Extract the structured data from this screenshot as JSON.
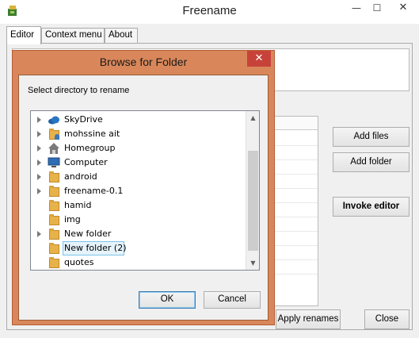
{
  "window": {
    "title": "Freename",
    "minimize": "—",
    "maximize": "☐",
    "close": "✕"
  },
  "tabs": [
    {
      "label": "Editor"
    },
    {
      "label": "Context menu"
    },
    {
      "label": "About"
    }
  ],
  "buttons": {
    "add_files": "Add files",
    "add_folder": "Add folder",
    "invoke_editor": "Invoke editor",
    "apply_renames": "Apply renames",
    "close": "Close"
  },
  "dialog": {
    "title": "Browse for Folder",
    "close": "✕",
    "prompt": "Select directory to rename",
    "ok": "OK",
    "cancel": "Cancel",
    "tree": [
      {
        "label": "SkyDrive",
        "icon": "cloud-icon",
        "expandable": true
      },
      {
        "label": "mohssine ait",
        "icon": "user-folder-icon",
        "expandable": true
      },
      {
        "label": "Homegroup",
        "icon": "homegroup-icon",
        "expandable": true
      },
      {
        "label": "Computer",
        "icon": "computer-icon",
        "expandable": true
      },
      {
        "label": "android",
        "icon": "folder-icon",
        "expandable": true
      },
      {
        "label": "freename-0.1",
        "icon": "folder-icon",
        "expandable": true
      },
      {
        "label": "hamid",
        "icon": "folder-icon",
        "expandable": false
      },
      {
        "label": "img",
        "icon": "folder-icon",
        "expandable": false
      },
      {
        "label": "New folder",
        "icon": "folder-icon",
        "expandable": true
      },
      {
        "label": "New folder (2)",
        "icon": "folder-icon",
        "expandable": false,
        "selected": true
      },
      {
        "label": "quotes",
        "icon": "folder-icon",
        "expandable": false
      }
    ]
  }
}
